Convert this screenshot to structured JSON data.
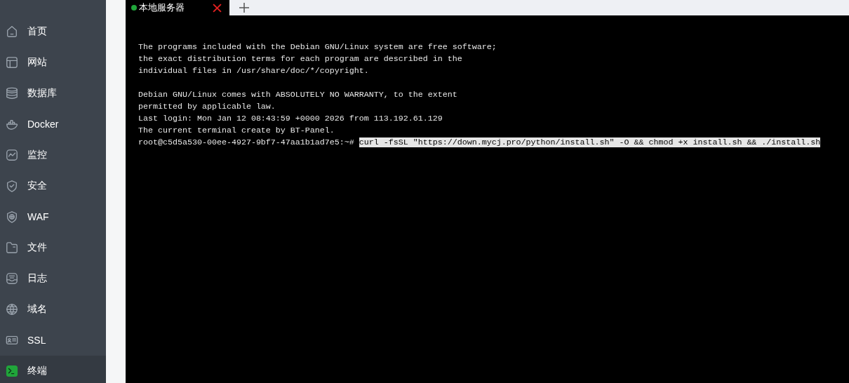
{
  "sidebar": {
    "items": [
      {
        "label": "首页",
        "selected": false
      },
      {
        "label": "网站",
        "selected": false
      },
      {
        "label": "数据库",
        "selected": false
      },
      {
        "label": "Docker",
        "selected": false
      },
      {
        "label": "监控",
        "selected": false
      },
      {
        "label": "安全",
        "selected": false
      },
      {
        "label": "WAF",
        "selected": false
      },
      {
        "label": "文件",
        "selected": false
      },
      {
        "label": "日志",
        "selected": false
      },
      {
        "label": "域名",
        "selected": false
      },
      {
        "label": "SSL",
        "selected": false
      },
      {
        "label": "终端",
        "selected": true
      }
    ]
  },
  "tabs": [
    {
      "label": "本地服务器",
      "selected": true
    }
  ],
  "terminal": {
    "paragraphs": [
      [
        "The programs included with the Debian GNU/Linux system are free software;",
        "the exact distribution terms for each program are described in the",
        "individual files in /usr/share/doc/*/copyright."
      ],
      [
        "Debian GNU/Linux comes with ABSOLUTELY NO WARRANTY, to the extent",
        "permitted by applicable law.",
        "Last login: Mon Jan 12 08:43:59 +0000 2026 from 113.192.61.129",
        "The current terminal create by BT-Panel."
      ]
    ],
    "prompt": "root@c5d5a530-00ee-4927-9bf7-47aa1b1ad7e5:~#",
    "command": {
      "text": "curl -fsSL \"https://down.mycj.pro/python/install.sh\" -O && chmod +x install.sh && ./install.sh",
      "selected": true
    }
  }
}
